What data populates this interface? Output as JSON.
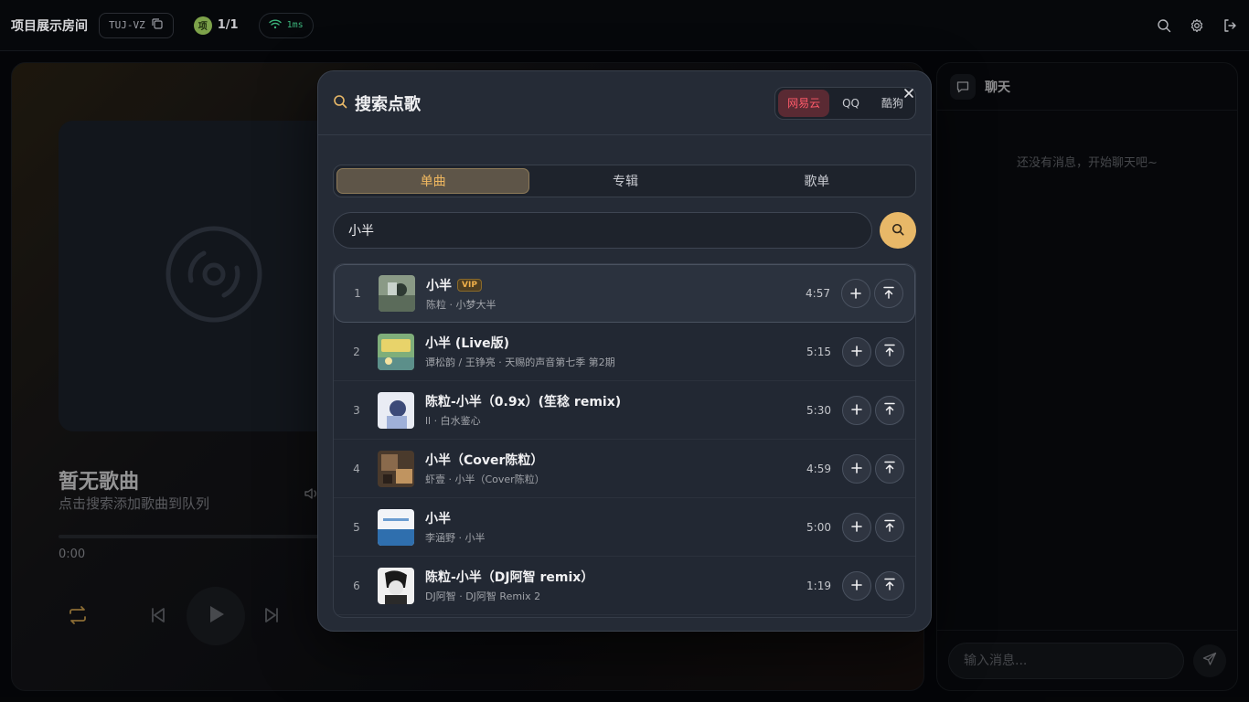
{
  "topbar": {
    "room_name": "项目展示房间",
    "room_code": "TUJ-VZ",
    "avatar_initial": "项",
    "user_count": "1/1",
    "latency": "1ms"
  },
  "player": {
    "track_title": "暂无歌曲",
    "track_subtitle": "点击搜索添加歌曲到队列",
    "time_current": "0:00",
    "progress": 0
  },
  "chat": {
    "title": "聊天",
    "empty_text": "还没有消息，开始聊天吧~",
    "input_placeholder": "输入消息..."
  },
  "modal": {
    "title": "搜索点歌",
    "sources": [
      "网易云",
      "QQ",
      "酷狗"
    ],
    "active_source": "网易云",
    "tabs": [
      "单曲",
      "专辑",
      "歌单"
    ],
    "active_tab": "单曲",
    "search_value": "小半",
    "results": [
      {
        "index": "1",
        "name": "小半",
        "vip": "VIP",
        "subtitle": "陈粒 · 小梦大半",
        "duration": "4:57"
      },
      {
        "index": "2",
        "name": "小半 (Live版)",
        "vip": "",
        "subtitle": "谭松韵 / 王铮亮 · 天赐的声音第七季 第2期",
        "duration": "5:15"
      },
      {
        "index": "3",
        "name": "陈粒-小半（0.9x）(笙稔 remix)",
        "vip": "",
        "subtitle": "ll · 白水鉴心",
        "duration": "5:30"
      },
      {
        "index": "4",
        "name": "小半（Cover陈粒）",
        "vip": "",
        "subtitle": "虾壹 · 小半（Cover陈粒）",
        "duration": "4:59"
      },
      {
        "index": "5",
        "name": "小半",
        "vip": "",
        "subtitle": "李涵野 · 小半",
        "duration": "5:00"
      },
      {
        "index": "6",
        "name": "陈粒-小半（DJ阿智 remix）",
        "vip": "",
        "subtitle": "DJ阿智 · DJ阿智 Remix 2",
        "duration": "1:19"
      }
    ]
  },
  "colors": {
    "accent": "#e8b868",
    "netease_red": "#ff5a6a",
    "ping_green": "#3bb37a"
  }
}
